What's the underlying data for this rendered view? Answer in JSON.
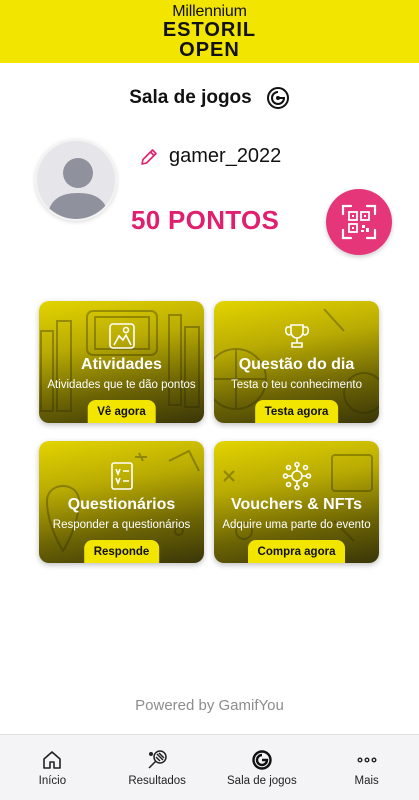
{
  "header": {
    "logo_line1": "Millennium",
    "logo_line2": "ESTORIL",
    "logo_line3": "OPEN",
    "background": "#f2e500"
  },
  "page": {
    "title": "Sala de jogos"
  },
  "profile": {
    "username": "gamer_2022",
    "points": "50 PONTOS",
    "accent": "#e0206e"
  },
  "cards": [
    {
      "title": "Atividades",
      "subtitle": "Atividades que te dão pontos",
      "button": "Vê agora",
      "icon": "activity-icon"
    },
    {
      "title": "Questão do dia",
      "subtitle": "Testa o teu conhecimento",
      "button": "Testa agora",
      "icon": "trophy-icon"
    },
    {
      "title": "Questionários",
      "subtitle": "Responder a questionários",
      "button": "Responde",
      "icon": "quiz-icon"
    },
    {
      "title": "Vouchers & NFTs",
      "subtitle": "Adquire uma parte do evento",
      "button": "Compra agora",
      "icon": "network-icon"
    }
  ],
  "footer": {
    "powered_by": "Powered by GamifYou"
  },
  "nav": [
    {
      "label": "Início",
      "icon": "home-icon"
    },
    {
      "label": "Resultados",
      "icon": "tennis-racket-icon"
    },
    {
      "label": "Sala de jogos",
      "icon": "game-room-icon"
    },
    {
      "label": "Mais",
      "icon": "more-icon"
    }
  ]
}
